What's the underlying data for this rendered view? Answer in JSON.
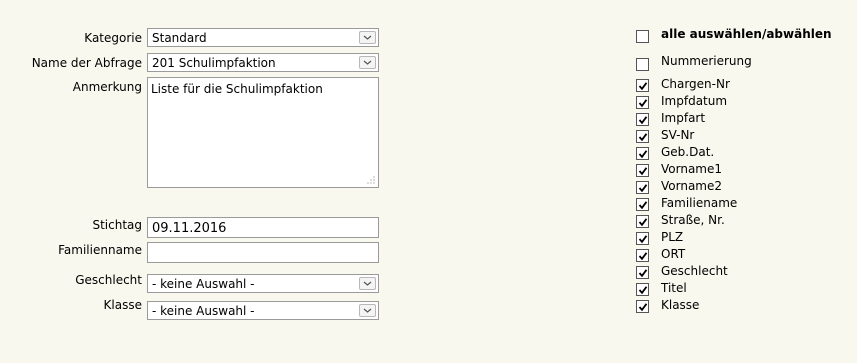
{
  "form": {
    "kategorie": {
      "label": "Kategorie",
      "value": "Standard"
    },
    "abfrage": {
      "label": "Name der Abfrage",
      "value": "201 Schulimpfaktion"
    },
    "anmerkung": {
      "label": "Anmerkung",
      "value": "Liste für die Schulimpfaktion"
    },
    "stichtag": {
      "label": "Stichtag",
      "value": "09.11.2016"
    },
    "familienname": {
      "label": "Familienname",
      "value": ""
    },
    "geschlecht": {
      "label": "Geschlecht",
      "value": "- keine Auswahl -"
    },
    "klasse": {
      "label": "Klasse",
      "value": "- keine Auswahl -"
    }
  },
  "columns": {
    "select_all": {
      "label": "alle auswählen/abwählen",
      "checked": false
    },
    "items": [
      {
        "label": "Nummerierung",
        "checked": false
      },
      {
        "label": "Chargen-Nr",
        "checked": true
      },
      {
        "label": "Impfdatum",
        "checked": true
      },
      {
        "label": "Impfart",
        "checked": true
      },
      {
        "label": "SV-Nr",
        "checked": true
      },
      {
        "label": "Geb.Dat.",
        "checked": true
      },
      {
        "label": "Vorname1",
        "checked": true
      },
      {
        "label": "Vorname2",
        "checked": true
      },
      {
        "label": "Familiename",
        "checked": true
      },
      {
        "label": "Straße, Nr.",
        "checked": true
      },
      {
        "label": "PLZ",
        "checked": true
      },
      {
        "label": "ORT",
        "checked": true
      },
      {
        "label": "Geschlecht",
        "checked": true
      },
      {
        "label": "Titel",
        "checked": true
      },
      {
        "label": "Klasse",
        "checked": true
      }
    ]
  }
}
